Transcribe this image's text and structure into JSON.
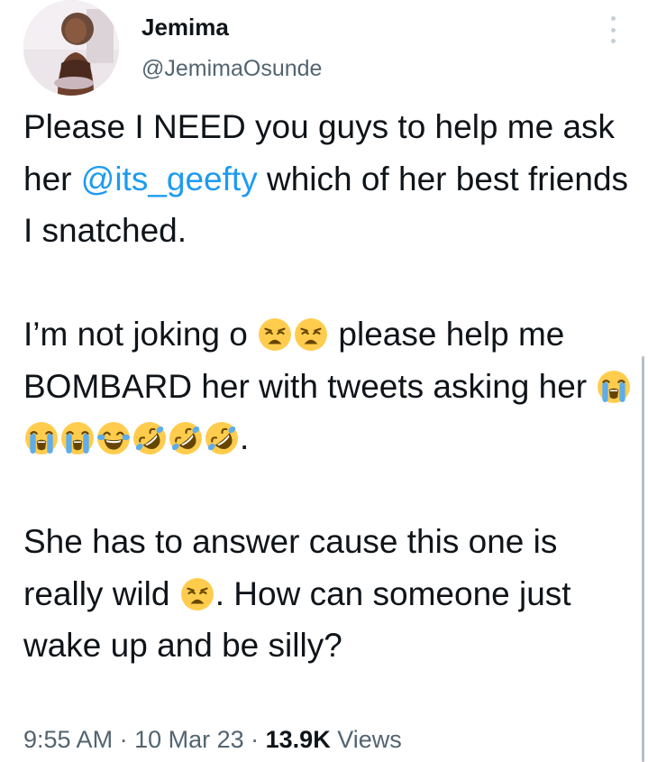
{
  "author": {
    "name": "Jemima",
    "handle": "@JemimaOsunde"
  },
  "tweet": {
    "p1": {
      "a": "Please I NEED you guys to help me ask her ",
      "mention": "@its_geefty",
      "b": " which of her best friends I snatched."
    },
    "p2": {
      "a": "I’m not joking o ",
      "b": " please help me BOMBARD her with tweets asking her ",
      "c": "."
    },
    "p3": {
      "a": "She has to answer cause this one is really wild ",
      "b": ". How can someone just wake up and be silly?"
    }
  },
  "meta": {
    "time": "9:55 AM",
    "sep1": " · ",
    "date": "10 Mar 23",
    "sep2": " · ",
    "views_count": "13.9K",
    "views_label": " Views"
  },
  "icons": {
    "more": "more-vertical-icon",
    "weary": "weary-face-emoji",
    "crying": "loudly-crying-face-emoji",
    "joy": "face-with-tears-of-joy-emoji",
    "rofl": "rolling-on-floor-laughing-emoji"
  },
  "colors": {
    "text": "#0f1419",
    "secondary": "#536471",
    "link": "#1d9bf0",
    "emoji_yellow": "#ffcc4d",
    "tear_blue": "#5dadec"
  }
}
